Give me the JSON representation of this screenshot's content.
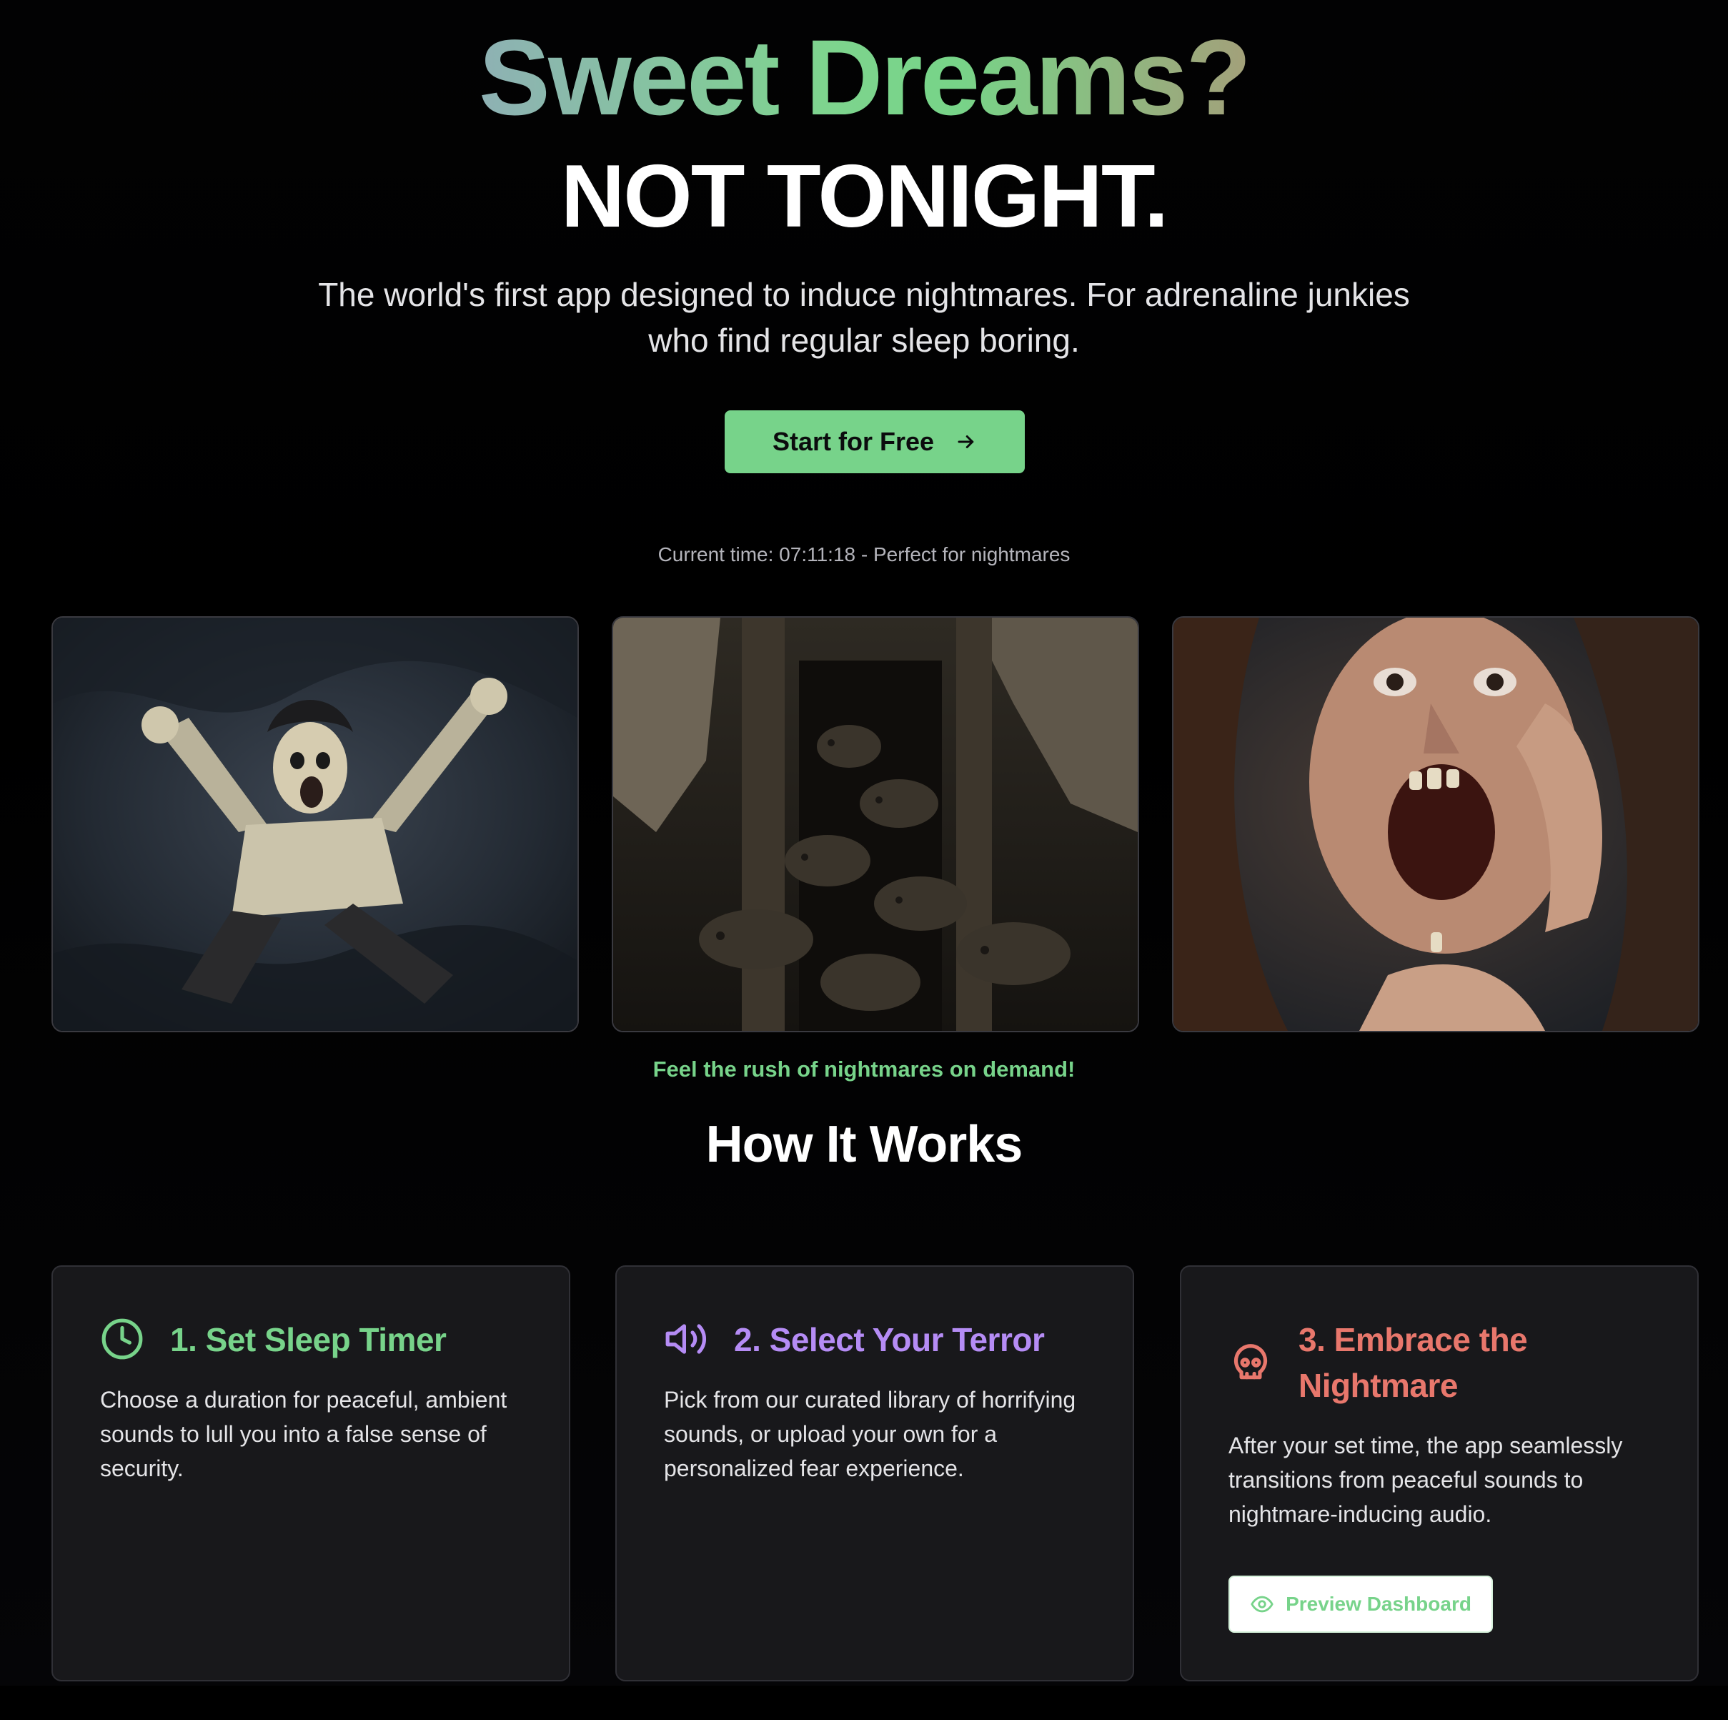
{
  "hero": {
    "title": "Sweet Dreams?",
    "subtitle": "NOT TONIGHT.",
    "description_line1": "The world's first app designed to induce nightmares. For adrenaline junkies",
    "description_line2": "who find regular sleep boring.",
    "cta_label": "Start for Free",
    "cta_icon": "arrow-right-icon"
  },
  "clock": {
    "text": "Current time: 07:11:18 - Perfect for nightmares"
  },
  "gallery": {
    "images": [
      {
        "name": "falling-man-image"
      },
      {
        "name": "rats-in-wall-image"
      },
      {
        "name": "teeth-falling-out-image"
      }
    ],
    "tagline": "Feel the rush of nightmares on demand!"
  },
  "how_it_works": {
    "title": "How It Works",
    "steps": [
      {
        "icon": "clock-icon",
        "title": "1. Set Sleep Timer",
        "description": "Choose a duration for peaceful, ambient sounds to lull you into a false sense of security.",
        "color": "#77d38a"
      },
      {
        "icon": "volume-icon",
        "title": "2. Select Your Terror",
        "description": "Pick from our curated library of horrifying sounds, or upload your own for a personalized fear experience.",
        "color": "#b58cf5"
      },
      {
        "icon": "skull-icon",
        "title": "3. Embrace the Nightmare",
        "description": "After your set time, the app seamlessly transitions from peaceful sounds to nightmare-inducing audio.",
        "color": "#e8776c"
      }
    ],
    "preview_button": {
      "label": "Preview Dashboard",
      "icon": "eye-icon"
    }
  },
  "colors": {
    "accent_green": "#77d38a",
    "accent_purple": "#b58cf5",
    "accent_red": "#e8776c",
    "background": "#000000",
    "card": "#18181b"
  }
}
